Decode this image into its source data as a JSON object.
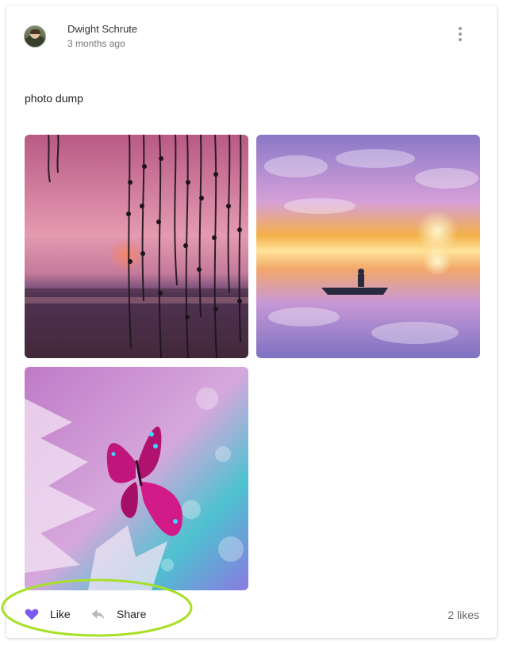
{
  "post": {
    "author": "Dwight Schrute",
    "timestamp": "3 months ago",
    "text": "photo dump",
    "more_icon": "more-vertical-icon"
  },
  "photos": [
    {
      "description": "Pink sunset over lake with hanging willow branches"
    },
    {
      "description": "Person in canoe on reflective lake under colorful clouds"
    },
    {
      "description": "Pink butterfly on frosted purple plant"
    }
  ],
  "actions": {
    "like_label": "Like",
    "like_icon": "heart-icon",
    "like_color": "#7c5cf0",
    "share_label": "Share",
    "share_icon": "reply-arrow-icon",
    "likes_count": "2 likes"
  },
  "annotation": {
    "highlight_color": "#a8e02a"
  }
}
